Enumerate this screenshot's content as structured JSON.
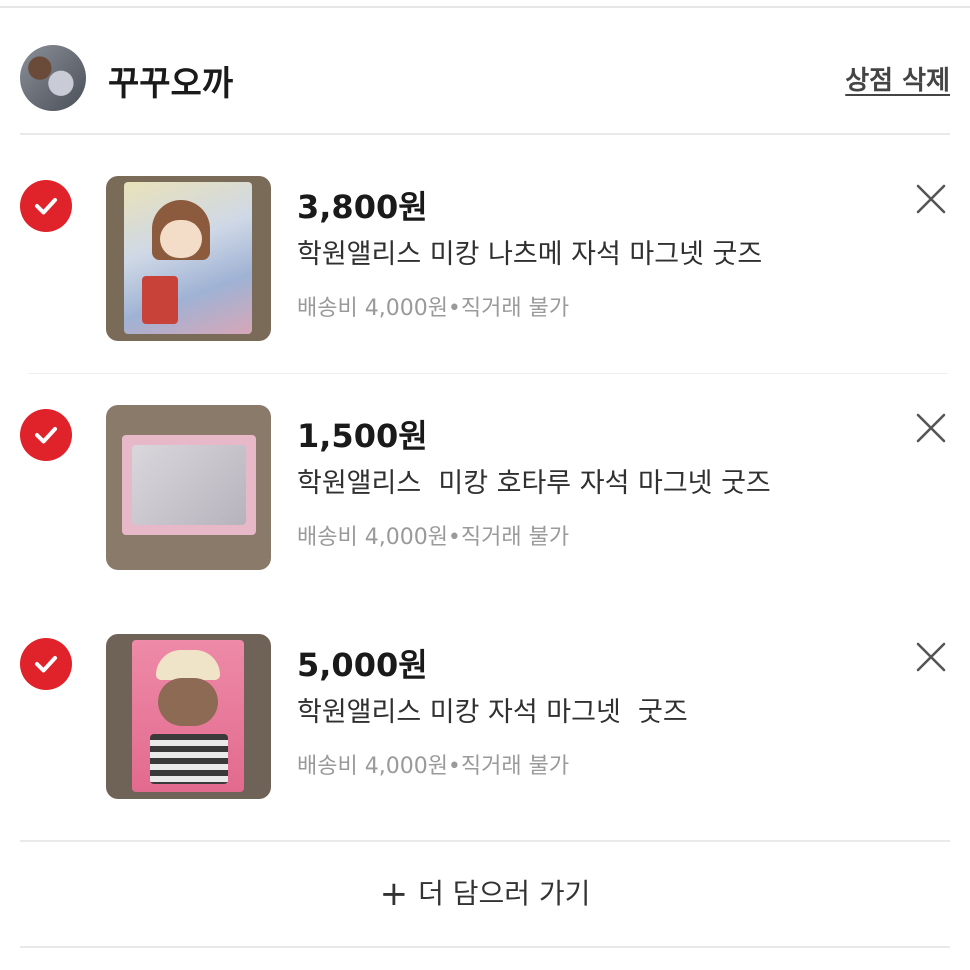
{
  "store": {
    "name": "꾸꾸오까",
    "delete_label": "상점 삭제"
  },
  "items": [
    {
      "price": "3,800원",
      "title": "학원앨리스 미캉 나츠메 자석 마그넷 굿즈",
      "shipping": "배송비 4,000원•직거래 불가",
      "checked": true
    },
    {
      "price": "1,500원",
      "title": "학원앨리스  미캉 호타루 자석 마그넷 굿즈",
      "shipping": "배송비 4,000원•직거래 불가",
      "checked": true
    },
    {
      "price": "5,000원",
      "title": "학원앨리스 미캉 자석 마그넷  굿즈",
      "shipping": "배송비 4,000원•직거래 불가",
      "checked": true
    }
  ],
  "add_more": {
    "icon": "plus-icon",
    "label": "더 담으러 가기"
  },
  "colors": {
    "accent": "#e0222a",
    "muted_text": "#9a9a9a",
    "divider": "#e9e9e9"
  }
}
